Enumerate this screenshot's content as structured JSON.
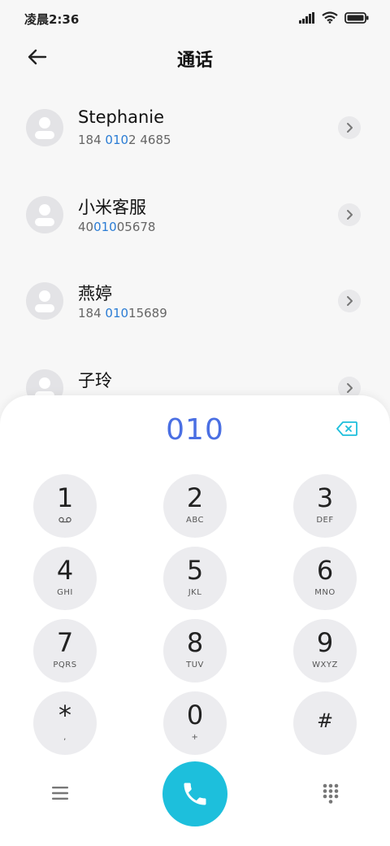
{
  "status_bar": {
    "time": "凌晨2:36"
  },
  "header": {
    "title": "通话"
  },
  "contacts": [
    {
      "name": "Stephanie",
      "number_pre": "184 ",
      "number_hl": "010",
      "number_post": "2 4685"
    },
    {
      "name": "小米客服",
      "number_pre": "40",
      "number_hl": "010",
      "number_post": "05678"
    },
    {
      "name": "燕婷",
      "number_pre": "184 ",
      "number_hl": "010",
      "number_post": "15689"
    },
    {
      "name": "子玲",
      "number_pre": "",
      "number_hl": "",
      "number_post": ""
    }
  ],
  "dialer": {
    "input": "010",
    "keys": [
      {
        "digit": "1",
        "letters": ""
      },
      {
        "digit": "2",
        "letters": "ABC"
      },
      {
        "digit": "3",
        "letters": "DEF"
      },
      {
        "digit": "4",
        "letters": "GHI"
      },
      {
        "digit": "5",
        "letters": "JKL"
      },
      {
        "digit": "6",
        "letters": "MNO"
      },
      {
        "digit": "7",
        "letters": "PQRS"
      },
      {
        "digit": "8",
        "letters": "TUV"
      },
      {
        "digit": "9",
        "letters": "WXYZ"
      },
      {
        "digit": "*",
        "letters": ","
      },
      {
        "digit": "0",
        "letters": "+"
      },
      {
        "digit": "#",
        "letters": ""
      }
    ]
  },
  "colors": {
    "accent": "#4a6fe3",
    "call_button": "#1dbfdc",
    "highlight": "#2a7cd4"
  },
  "icons": {
    "voicemail": "voicemail-icon",
    "back": "back-arrow-icon",
    "call": "phone-icon"
  }
}
